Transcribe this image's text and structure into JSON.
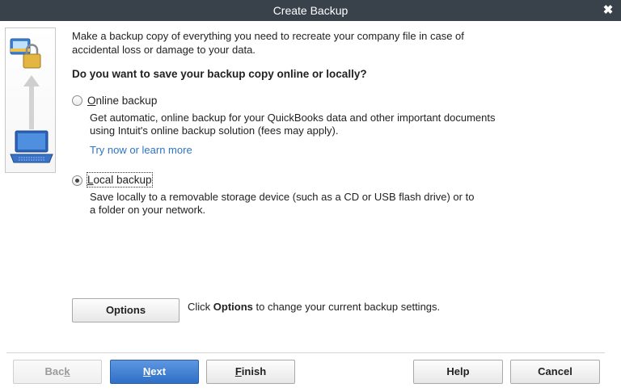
{
  "window": {
    "title": "Create Backup",
    "close_glyph": "✖"
  },
  "side_panel": {
    "icons": [
      "company-file-lock-icon",
      "up-arrow-icon",
      "laptop-icon"
    ]
  },
  "intro": {
    "line1": "Make a backup copy of everything you need to recreate your company file in case of",
    "line2": "accidental loss or damage to your data."
  },
  "question": "Do you want to save your backup copy online or locally?",
  "online": {
    "label_accel": "O",
    "label_rest": "nline backup",
    "selected": false,
    "desc_line1": "Get automatic, online backup for your QuickBooks data and other important documents",
    "desc_line2": "using Intuit's online backup solution (fees may apply).",
    "link": "Try now or learn more"
  },
  "local": {
    "label_accel": "L",
    "label_rest": "ocal backup",
    "selected": true,
    "desc_line1": "Save locally to a removable storage device (such as a CD or USB flash drive) or to",
    "desc_line2": "a folder on your network."
  },
  "options": {
    "button_label": "Options",
    "hint_prefix": "Click ",
    "hint_bold": "Options",
    "hint_suffix": " to change your current backup settings."
  },
  "footer": {
    "back_prefix": "Bac",
    "back_accel": "k",
    "next_accel": "N",
    "next_rest": "ext",
    "finish_accel": "F",
    "finish_rest": "inish",
    "help": "Help",
    "cancel": "Cancel"
  },
  "colors": {
    "titlebar": "#39414a",
    "link": "#2e74c8",
    "primary_button": "#2f6fc6"
  }
}
